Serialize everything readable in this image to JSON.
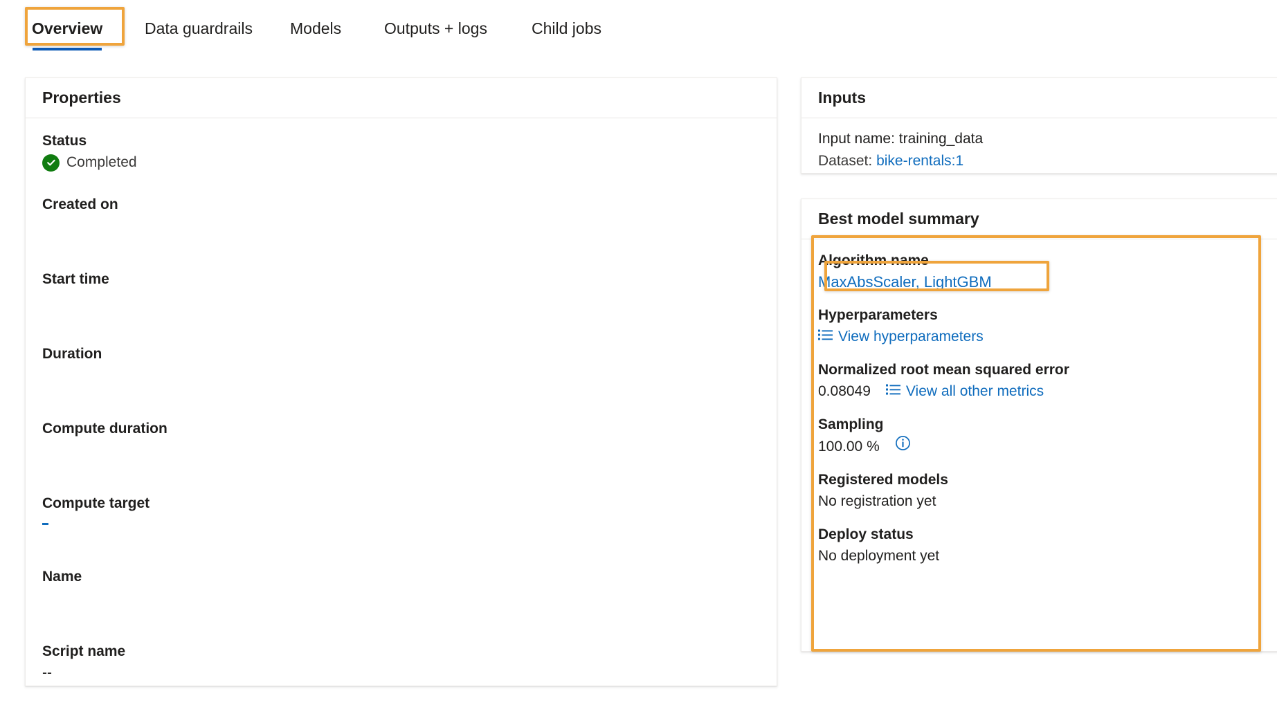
{
  "tabs": [
    {
      "label": "Overview",
      "selected": true
    },
    {
      "label": "Data guardrails",
      "selected": false
    },
    {
      "label": "Models",
      "selected": false
    },
    {
      "label": "Outputs + logs",
      "selected": false
    },
    {
      "label": "Child jobs",
      "selected": false
    }
  ],
  "properties": {
    "title": "Properties",
    "rows": [
      {
        "label": "Status",
        "value": "Completed",
        "icon": "check-circle-icon"
      },
      {
        "label": "Created on",
        "value": ""
      },
      {
        "label": "Start time",
        "value": ""
      },
      {
        "label": "Duration",
        "value": ""
      },
      {
        "label": "Compute duration",
        "value": ""
      },
      {
        "label": "Compute target",
        "value": ""
      },
      {
        "label": "Name",
        "value": ""
      },
      {
        "label": "Script name",
        "value": "--"
      }
    ]
  },
  "inputs": {
    "title": "Inputs",
    "input_name_label": "Input name:",
    "input_name_value": "training_data",
    "dataset_label": "Dataset:",
    "dataset_link": "bike-rentals:1"
  },
  "best_model": {
    "title": "Best model summary",
    "algorithm_label": "Algorithm name",
    "algorithm_link": "MaxAbsScaler, LightGBM",
    "hyperparameters_label": "Hyperparameters",
    "hyperparameters_link": "View hyperparameters",
    "metric_label": "Normalized root mean squared error",
    "metric_value": "0.08049",
    "metric_link": "View all other metrics",
    "sampling_label": "Sampling",
    "sampling_value": "100.00 %",
    "registered_models_label": "Registered models",
    "registered_models_value": "No registration yet",
    "deploy_status_label": "Deploy status",
    "deploy_status_value": "No deployment yet"
  },
  "colors": {
    "highlight": "#efa43c",
    "link": "#0f6cbd",
    "success": "#107c10",
    "tab_underline": "#0f5bb5"
  }
}
